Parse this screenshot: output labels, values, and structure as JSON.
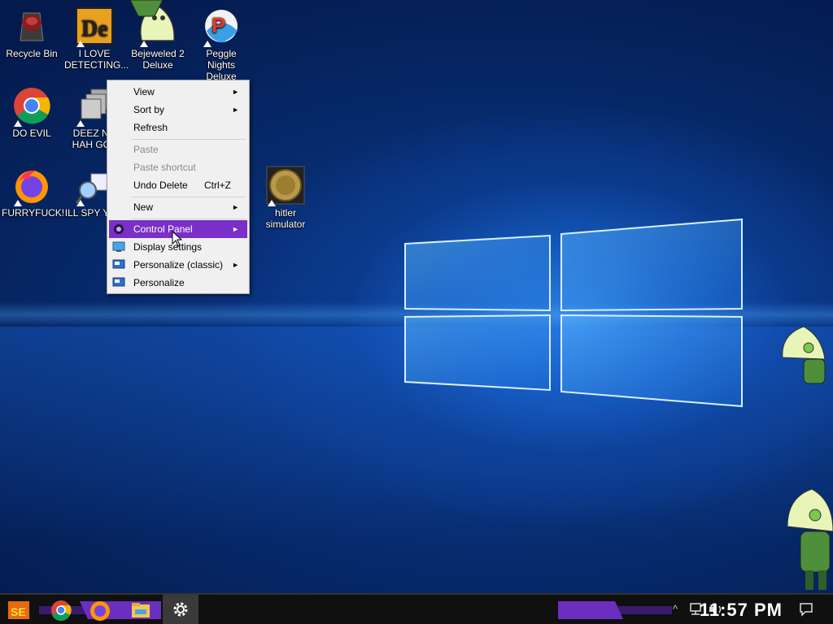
{
  "desktop": {
    "icons": [
      {
        "label": "Recycle Bin",
        "icon": "recycle-bin-icon"
      },
      {
        "label": "I LOVE DETECTING...",
        "icon": "detective-game-icon"
      },
      {
        "label": "Bejeweled 2 Deluxe",
        "icon": "bejeweled-icon"
      },
      {
        "label": "Peggle Nights Deluxe",
        "icon": "peggle-icon"
      },
      {
        "label": "DO EVIL",
        "icon": "chrome-icon"
      },
      {
        "label": "DEEZ NU HAH GOT",
        "icon": "folder-stack-icon"
      },
      {
        "label": "FURRYFUCK!",
        "icon": "firefox-icon"
      },
      {
        "label": "ILL SPY YOU",
        "icon": "spy-icon"
      },
      {
        "label": "hitler simulator",
        "icon": "coin-icon"
      }
    ]
  },
  "context_menu": {
    "items": [
      {
        "label": "View",
        "submenu": "►"
      },
      {
        "label": "Sort by",
        "submenu": "►"
      },
      {
        "label": "Refresh"
      },
      {
        "label": "Paste",
        "disabled": true
      },
      {
        "label": "Paste shortcut",
        "disabled": true
      },
      {
        "label": "Undo Delete",
        "shortcut": "Ctrl+Z"
      },
      {
        "label": "New",
        "submenu": "►"
      },
      {
        "label": "Control Panel",
        "submenu": "►",
        "highlighted": true
      },
      {
        "label": "Display settings"
      },
      {
        "label": "Personalize (classic)",
        "submenu": "►"
      },
      {
        "label": "Personalize"
      }
    ]
  },
  "taskbar": {
    "clock": "11:57 PM",
    "tray_chevron": "^",
    "apps": [
      "start-logo-icon",
      "chrome-icon",
      "firefox-icon",
      "file-explorer-icon",
      "settings-gear-icon"
    ]
  },
  "colors": {
    "menu_highlight": "#7a2fc8",
    "taskbar": "#101010",
    "desktop_bg": "#041a4d"
  }
}
